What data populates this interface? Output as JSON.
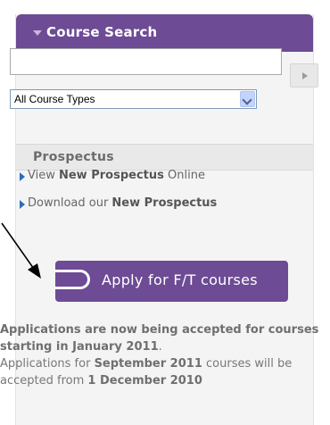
{
  "course_search": {
    "title": "Course Search",
    "search_placeholder": "",
    "select_value": "All Course Types"
  },
  "prospectus": {
    "title": "Prospectus",
    "links": [
      {
        "prefix": "View ",
        "bold": "New Prospectus",
        "suffix": " Online"
      },
      {
        "prefix": "Download our ",
        "bold": "New Prospectus",
        "suffix": ""
      }
    ]
  },
  "apply": {
    "label": "Apply for F/T courses"
  },
  "applications": {
    "line1": "Applications are now being accepted for courses starting in January 2011",
    "line1_end": ".",
    "line2_a": "Applications for ",
    "line2_b": "September 2011",
    "line2_c": " courses will be accepted from ",
    "line2_d": "1 December 2010"
  },
  "colors": {
    "brand_purple": "#6d4b95",
    "link_bullet": "#2b6cc4"
  },
  "icons": [
    "triangle-down-icon",
    "play-arrow-icon",
    "dropdown-chevron-icon",
    "bullet-arrow-icon",
    "pill-icon",
    "pointer-arrow-icon"
  ]
}
